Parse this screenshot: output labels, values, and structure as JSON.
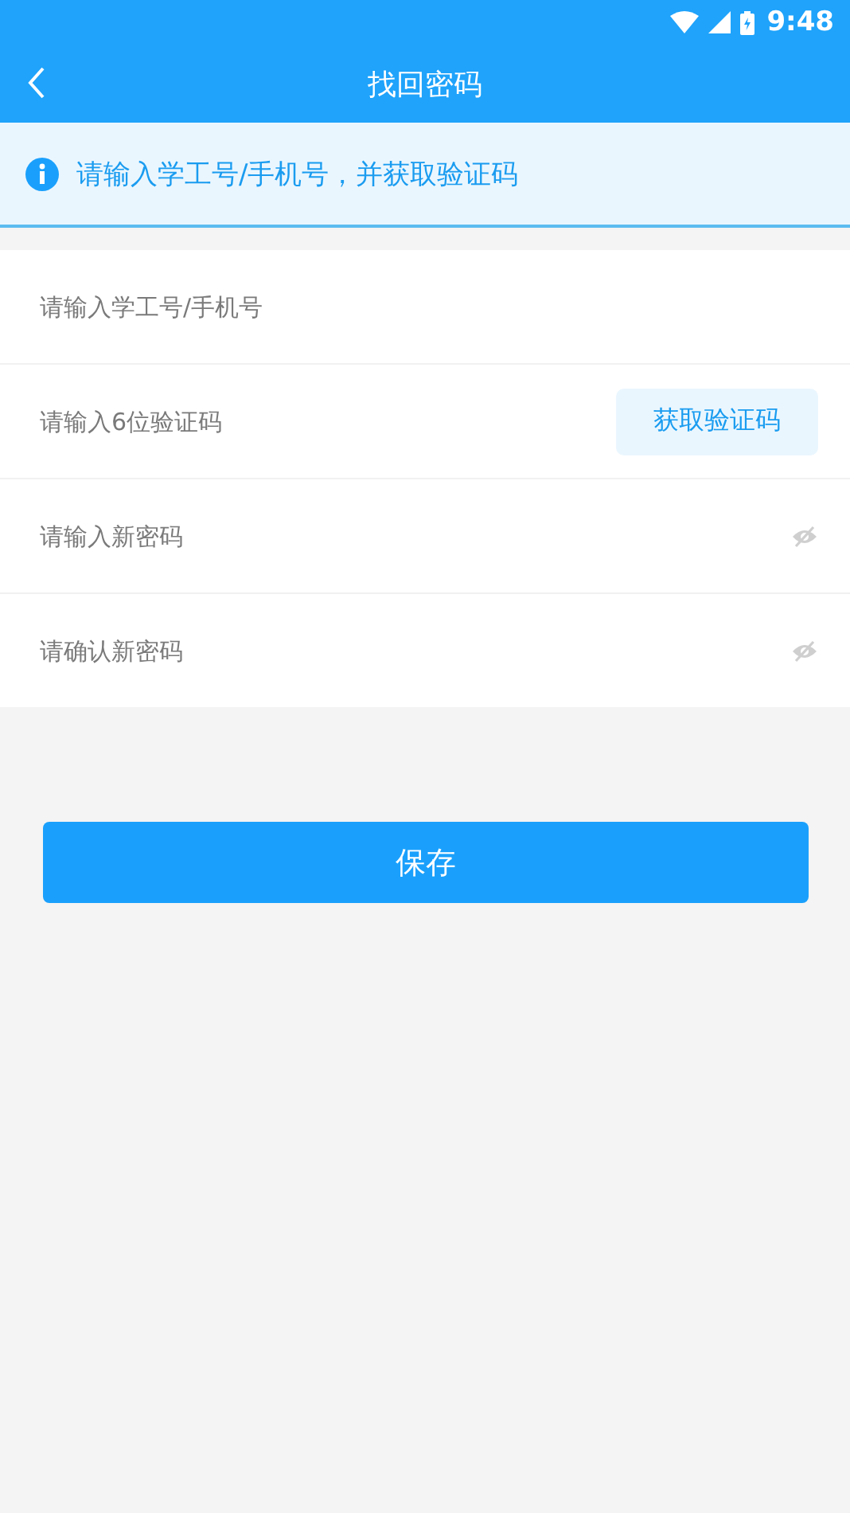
{
  "status_bar": {
    "time": "9:48"
  },
  "nav": {
    "title": "找回密码"
  },
  "notice": {
    "text": "请输入学工号/手机号，并获取验证码"
  },
  "fields": [
    {
      "kind": "text",
      "placeholder": "请输入学工号/手机号"
    },
    {
      "kind": "code",
      "placeholder": "请输入6位验证码",
      "button": "获取验证码"
    },
    {
      "kind": "password",
      "placeholder": "请输入新密码"
    },
    {
      "kind": "password",
      "placeholder": "请确认新密码"
    }
  ],
  "save_button": "保存"
}
